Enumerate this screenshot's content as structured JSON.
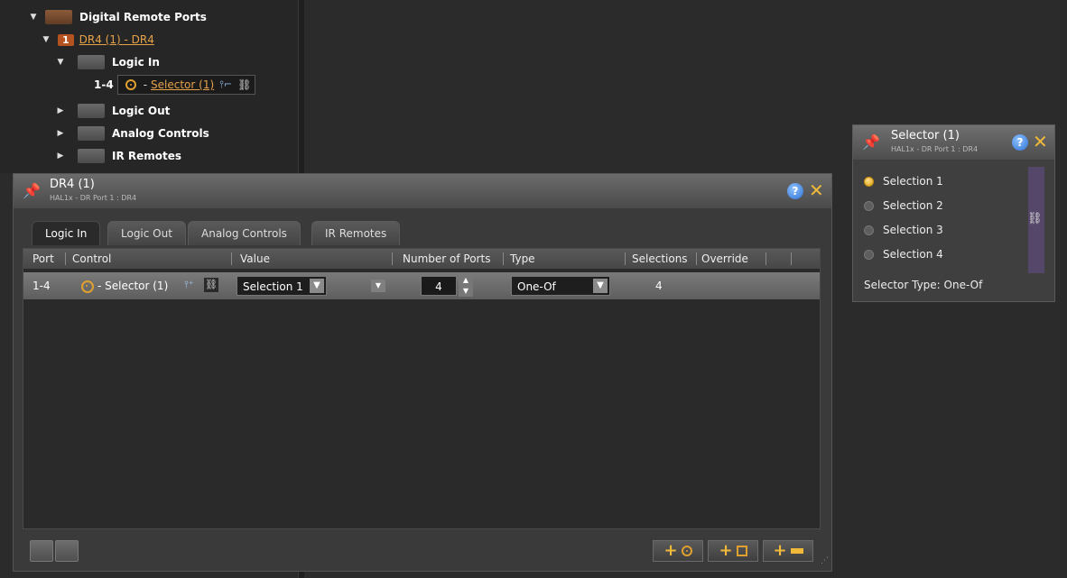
{
  "tree": {
    "root_label": "Digital Remote Ports",
    "device_num": "1",
    "device_link": "DR4 (1) - DR4",
    "logic_in_label": "Logic In",
    "port_range": "1-4",
    "selector_link": "Selector (1)",
    "children": [
      "Logic Out",
      "Analog Controls",
      "IR Remotes"
    ]
  },
  "panel": {
    "title": "DR4 (1)",
    "subtitle": "HAL1x - DR Port 1 : DR4",
    "tabs": [
      "Logic In",
      "Logic Out",
      "Analog Controls",
      "IR Remotes"
    ],
    "active_tab": "Logic In",
    "columns": [
      "Port",
      "Control",
      "Value",
      "Number of Ports",
      "Type",
      "Selections",
      "Override"
    ],
    "row": {
      "port": "1-4",
      "control": "- Selector (1)",
      "value": "Selection 1",
      "num_ports": "4",
      "type": "One-Of",
      "selections": "4"
    }
  },
  "selector": {
    "title": "Selector (1)",
    "subtitle": "HAL1x - DR Port 1 : DR4",
    "options": [
      "Selection 1",
      "Selection 2",
      "Selection 3",
      "Selection 4"
    ],
    "selected_index": 0,
    "type_text": "Selector Type: One-Of"
  },
  "colors": {
    "accent": "#f0b93a",
    "link": "#e6a24a",
    "help": "#2c6fd1"
  }
}
